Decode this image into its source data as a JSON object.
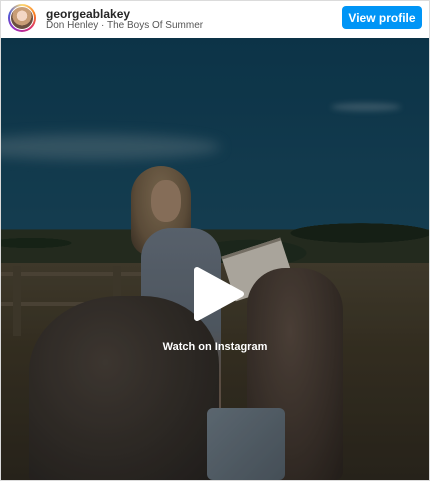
{
  "header": {
    "username": "georgeablakey",
    "audio_track": "Don Henley · The Boys Of Summer",
    "view_profile_label": "View profile"
  },
  "media": {
    "watch_label": "Watch on Instagram"
  },
  "colors": {
    "accent": "#0095f6"
  },
  "icons": {
    "play": "play-icon",
    "avatar": "avatar"
  }
}
